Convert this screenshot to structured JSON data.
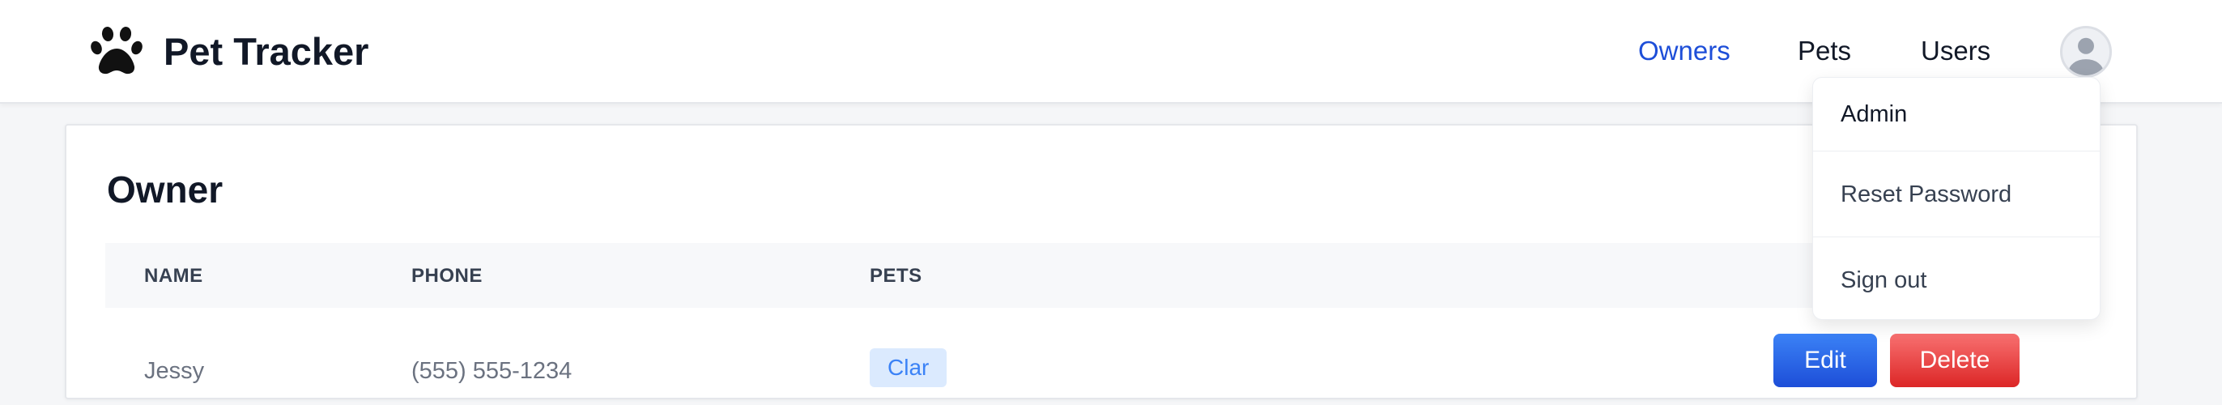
{
  "header": {
    "brand_icon": "paw-icon",
    "title": "Pet Tracker",
    "nav": [
      {
        "label": "Owners",
        "active": true
      },
      {
        "label": "Pets",
        "active": false
      },
      {
        "label": "Users",
        "active": false
      }
    ],
    "avatar_icon": "user-avatar-icon"
  },
  "user_menu": {
    "items": [
      "Admin",
      "Reset Password",
      "Sign out"
    ]
  },
  "main": {
    "title": "Owner",
    "table": {
      "columns": [
        "NAME",
        "PHONE",
        "PETS"
      ],
      "rows": [
        {
          "name": "Jessy",
          "phone": "(555) 555-1234",
          "pets": [
            "Clar"
          ],
          "actions": {
            "edit": "Edit",
            "delete": "Delete"
          }
        }
      ]
    }
  },
  "colors": {
    "accent": "#1d4ed8",
    "edit_button": "#2563eb",
    "delete_button": "#ef4444",
    "pet_chip_bg": "#dbeafe",
    "pet_chip_text": "#3b82f6"
  }
}
